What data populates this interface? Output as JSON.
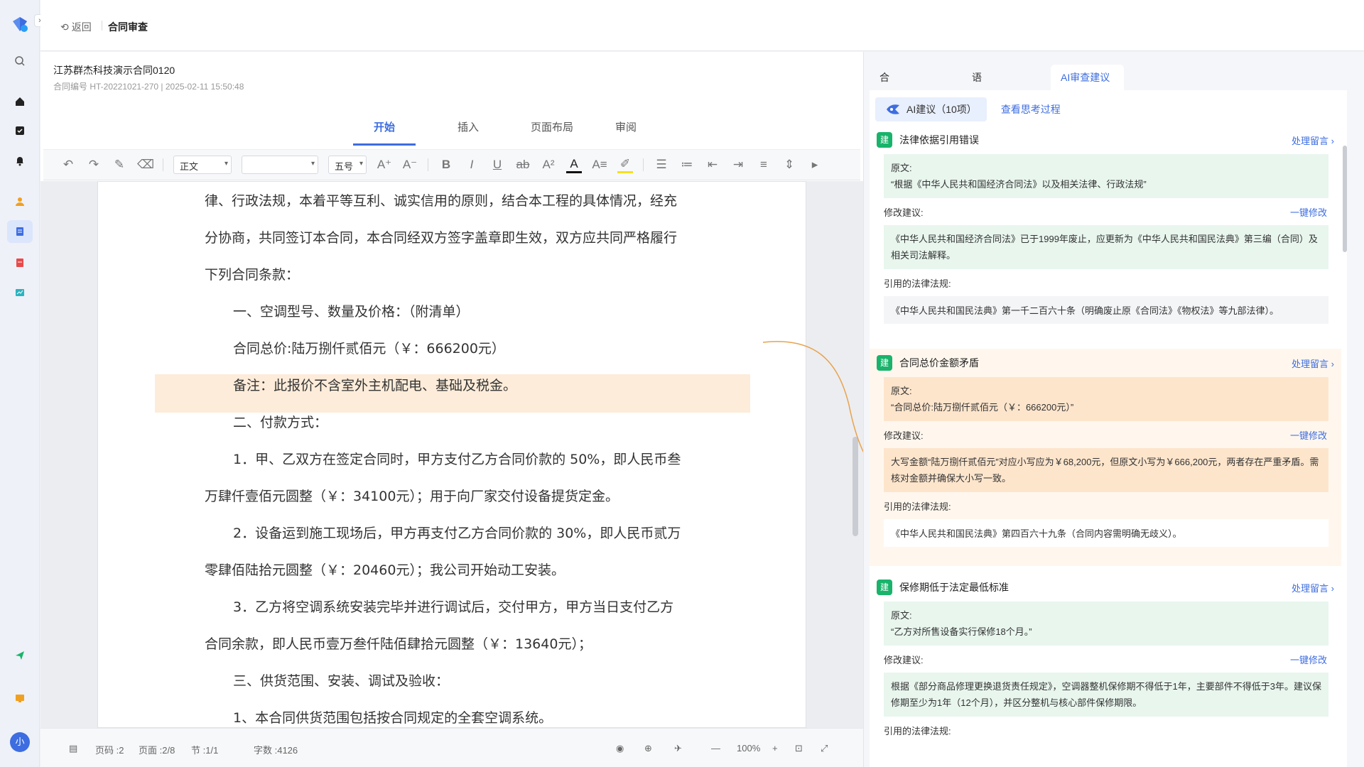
{
  "topbar": {
    "back_label": "返回",
    "title": "合同审查"
  },
  "document": {
    "name": "江苏群杰科技演示合同0120",
    "meta": "合同编号 HT-20221021-270 | 2025-02-11 15:50:48",
    "ribbon_tabs": [
      "开始",
      "插入",
      "页面布局",
      "审阅"
    ],
    "active_tab": "开始",
    "toolbar": {
      "style": "正文",
      "font": "",
      "size": "五号"
    },
    "paragraphs": [
      "律、行政法规，本着平等互利、诚实信用的原则，结合本工程的具体情况，经充",
      "分协商，共同签订本合同，本合同经双方签字盖章即生效，双方应共同严格履行",
      "下列合同条款：",
      "一、空调型号、数量及价格：（附清单）",
      "合同总价:陆万捌仟贰佰元（￥：666200元）",
      "备注：此报价不含室外主机配电、基础及税金。",
      "二、付款方式：",
      "1．甲、乙双方在签定合同时，甲方支付乙方合同价款的 50%，即人民币叁",
      "万肆仟壹佰元圆整（￥：34100元）；用于向厂家交付设备提货定金。",
      "2．设备运到施工现场后，甲方再支付乙方合同价款的 30%，即人民币贰万",
      "零肆佰陆拾元圆整（￥：20460元）；我公司开始动工安装。",
      "3．乙方将空调系统安装完毕并进行调试后，交付甲方，甲方当日支付乙方",
      "合同余款，即人民币壹万叁仟陆佰肆拾元圆整（￥：13640元）；",
      "三、供货范围、安装、调试及验收：",
      "1、本合同供货范围包括按合同规定的全套空调系统。"
    ],
    "status": {
      "page_code": "页码 :2",
      "page": "页面 :2/8",
      "section": "节 :1/1",
      "words": "字数 :4126",
      "zoom": "100%"
    }
  },
  "ai_panel": {
    "tabs": [
      "合同业务审查",
      "语法语义审查",
      "AI审查建议"
    ],
    "active_tab": "AI审查建议",
    "count_label": "AI建议（10项）",
    "think_label": "查看思考过程",
    "badge_label": "建",
    "action_label": "处理留言",
    "orig_label": "原文:",
    "suggest_label": "修改建议:",
    "fix_label": "一键修改",
    "law_label": "引用的法律法规:",
    "cards": [
      {
        "title": "法律依据引用错误",
        "original": "“根据《中华人民共和国经济合同法》以及相关法律、行政法规”",
        "suggestion": "《中华人民共和国经济合同法》已于1999年废止，应更新为《中华人民共和国民法典》第三编（合同）及相关司法解释。",
        "law": "《中华人民共和国民法典》第一千二百六十条（明确废止原《合同法》《物权法》等九部法律）。"
      },
      {
        "title": "合同总价金额矛盾",
        "original": "“合同总价:陆万捌仟贰佰元（￥：666200元）”",
        "suggestion": "大写金额“陆万捌仟贰佰元”对应小写应为￥68,200元，但原文小写为￥666,200元，两者存在严重矛盾。需核对金额并确保大小写一致。",
        "law": "《中华人民共和国民法典》第四百六十九条（合同内容需明确无歧义）。"
      },
      {
        "title": "保修期低于法定最低标准",
        "original": "“乙方对所售设备实行保修18个月。”",
        "suggestion": "根据《部分商品修理更换退货责任规定》，空调器整机保修期不得低于1年，主要部件不得低于3年。建议保修期至少为1年（12个月），并区分整机与核心部件保修期限。",
        "law": ""
      }
    ]
  },
  "colors": {
    "accent": "#3d6de0",
    "highlight": "#fdecd9",
    "green_badge": "#19b36b",
    "connector": "#e8a24c"
  }
}
